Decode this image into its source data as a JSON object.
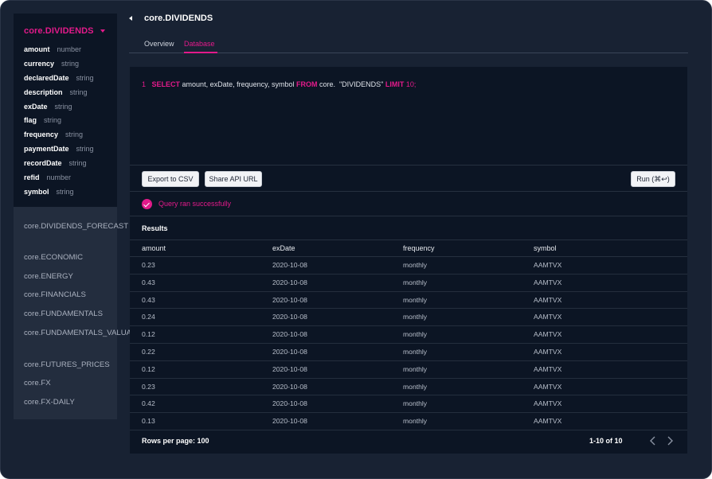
{
  "sidebar": {
    "title": "core.DIVIDENDS",
    "fields": [
      {
        "name": "amount",
        "type": "number"
      },
      {
        "name": "currency",
        "type": "string"
      },
      {
        "name": "declaredDate",
        "type": "string"
      },
      {
        "name": "description",
        "type": "string"
      },
      {
        "name": "exDate",
        "type": "string"
      },
      {
        "name": "flag",
        "type": "string"
      },
      {
        "name": "frequency",
        "type": "string"
      },
      {
        "name": "paymentDate",
        "type": "string"
      },
      {
        "name": "recordDate",
        "type": "string"
      },
      {
        "name": "refid",
        "type": "number"
      },
      {
        "name": "symbol",
        "type": "string"
      }
    ],
    "tables": [
      "core.DIVIDENDS_FORECAST",
      "core.ECONOMIC",
      "core.ENERGY",
      "core.FINANCIALS",
      "core.FUNDAMENTALS",
      "core.FUNDAMENTALS_VALUATIONS",
      "core.FUTURES_PRICES",
      "core.FX",
      "core.FX-DAILY"
    ]
  },
  "header": {
    "title": "core.DIVIDENDS",
    "tabs": [
      {
        "label": "Overview",
        "active": false
      },
      {
        "label": "Database",
        "active": true
      }
    ]
  },
  "editor": {
    "line_number": "1",
    "select_kw": "SELECT",
    "columns": " amount, exDate, frequency, symbol ",
    "from_kw": "FROM",
    "table": " core.  \"DIVIDENDS\" ",
    "limit_kw": "LIMIT",
    "limit_value": " 10;"
  },
  "toolbar": {
    "export_label": "Export to CSV",
    "share_label": "Share API URL",
    "run_label": "Run (⌘↩)"
  },
  "status": {
    "message": "Query ran successfully"
  },
  "results": {
    "title": "Results",
    "columns": [
      "amount",
      "exDate",
      "frequency",
      "symbol"
    ],
    "rows": [
      [
        "0.23",
        "2020-10-08",
        "monthly",
        "AAMTVX"
      ],
      [
        "0.43",
        "2020-10-08",
        "monthly",
        "AAMTVX"
      ],
      [
        "0.43",
        "2020-10-08",
        "monthly",
        "AAMTVX"
      ],
      [
        "0.24",
        "2020-10-08",
        "monthly",
        "AAMTVX"
      ],
      [
        "0.12",
        "2020-10-08",
        "monthly",
        "AAMTVX"
      ],
      [
        "0.22",
        "2020-10-08",
        "monthly",
        "AAMTVX"
      ],
      [
        "0.12",
        "2020-10-08",
        "monthly",
        "AAMTVX"
      ],
      [
        "0.23",
        "2020-10-08",
        "monthly",
        "AAMTVX"
      ],
      [
        "0.42",
        "2020-10-08",
        "monthly",
        "AAMTVX"
      ],
      [
        "0.13",
        "2020-10-08",
        "monthly",
        "AAMTVX"
      ]
    ],
    "rows_per_page": "Rows per page: 100",
    "page_range": "1-10 of 10"
  },
  "colors": {
    "accent": "#e21a8a",
    "background": "#182233",
    "panel": "#0c1524"
  }
}
